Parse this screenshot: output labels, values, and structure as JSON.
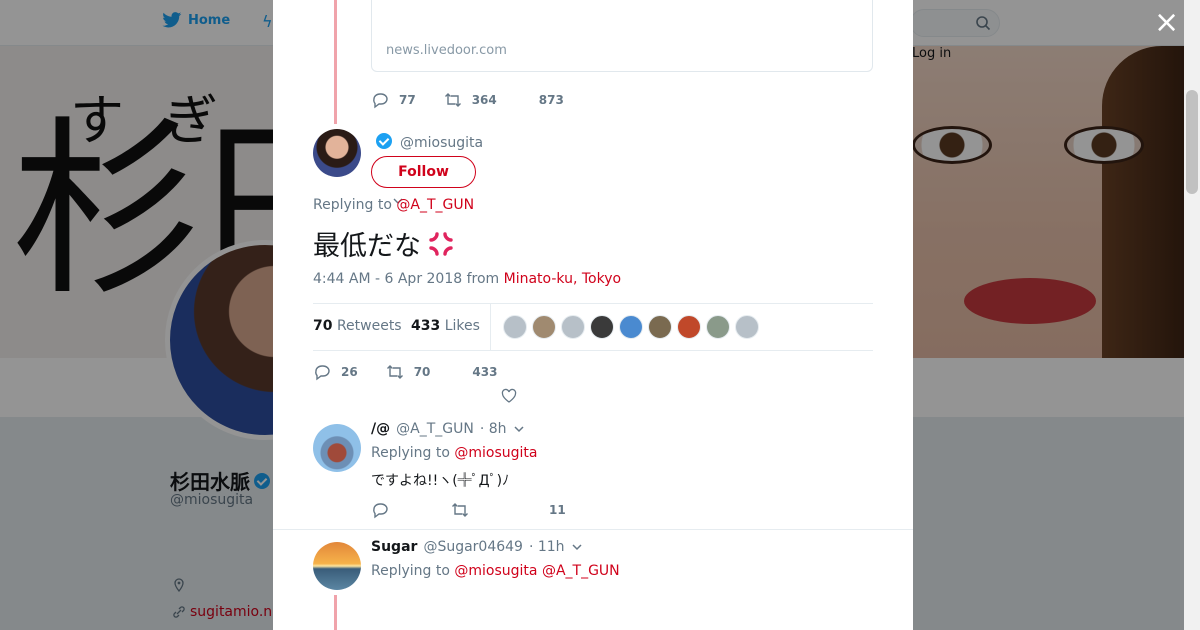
{
  "background": {
    "nav": {
      "home_label": "Home",
      "login_label": "Log in"
    },
    "banner": {
      "kanji_small": "すぎ",
      "kanji_big": "杉田"
    },
    "profile": {
      "name": "杉田水脈",
      "handle": "@miosugita",
      "link": "sugitamio.n"
    }
  },
  "modal": {
    "card": {
      "domain": "news.livedoor.com"
    },
    "prev_actions": {
      "replies": "77",
      "retweets": "364",
      "likes": "873"
    },
    "main_tweet": {
      "handle": "@miosugita",
      "follow_label": "Follow",
      "replying_prefix": "Replying to",
      "replying_to": "@A_T_GUN",
      "text": "最低だな",
      "timestamp": "4:44 AM - 6 Apr 2018 from",
      "location": "Minato-ku, Tokyo",
      "retweets_count": "70",
      "retweets_label": "Retweets",
      "likes_count": "433",
      "likes_label": "Likes",
      "likers": [
        "#b7c0c8",
        "#a08a70",
        "#b7c0c8",
        "#3a3a3a",
        "#4a8ad0",
        "#7a6a50",
        "#c0482a",
        "#8a9a8a",
        "#b7c0c8"
      ],
      "actions": {
        "replies": "26",
        "retweets": "70",
        "likes": "433"
      }
    },
    "replies": [
      {
        "name": "/@",
        "handle": "@A_T_GUN",
        "time": "· 8h",
        "replying_prefix": "Replying to",
        "replying_to": "@miosugita",
        "text": "ですよね!!ヽ(╬ﾟДﾟ)ﾉ",
        "likes": "11"
      },
      {
        "name": "Sugar",
        "handle": "@Sugar04649",
        "time": "· 11h",
        "replying_prefix": "Replying to",
        "replying_to_1": "@miosugita",
        "replying_to_2": "@A_T_GUN"
      }
    ]
  },
  "colors": {
    "accent": "#d0021b",
    "twitter_blue": "#1da1f2",
    "thread_line": "#f0a3ab"
  }
}
